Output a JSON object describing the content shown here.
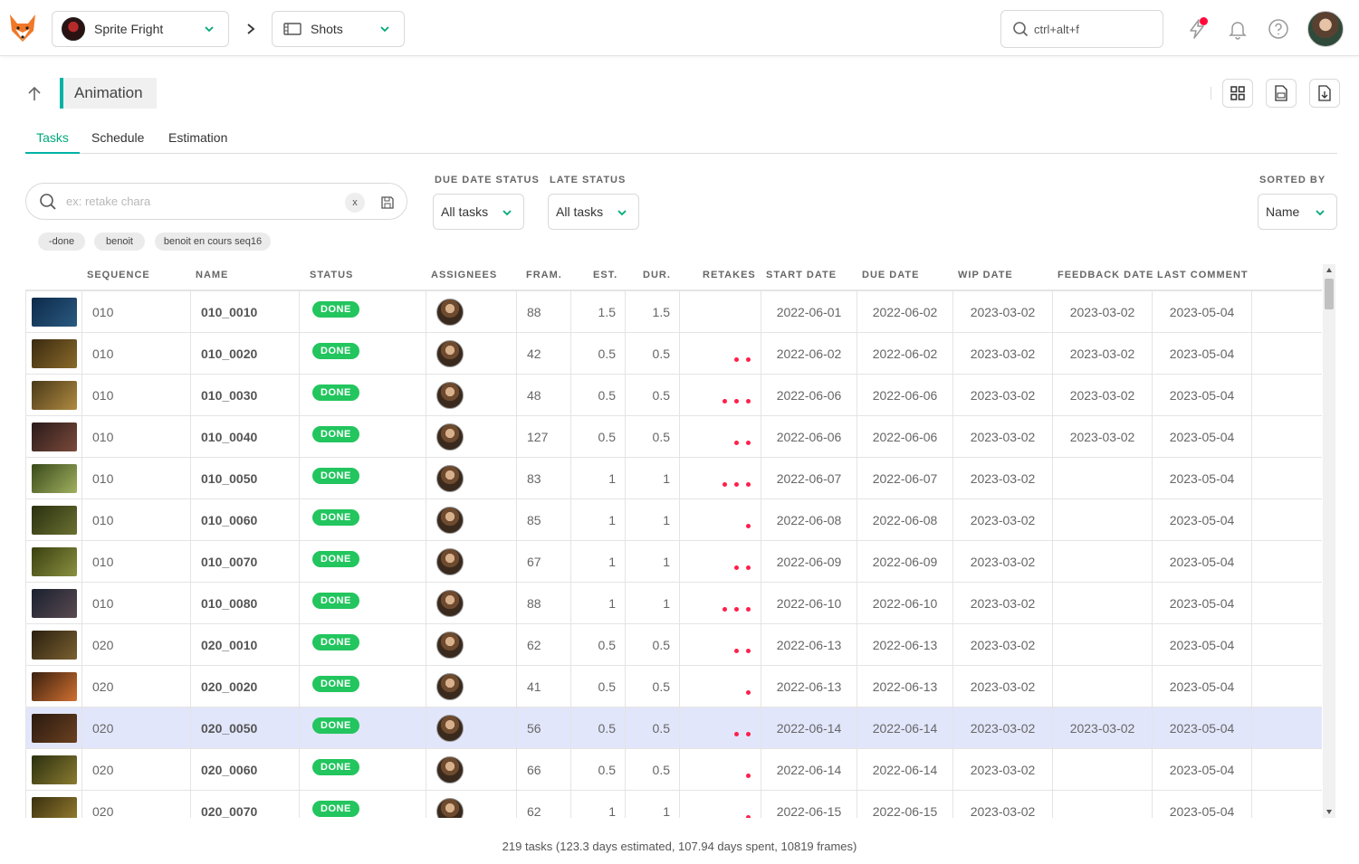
{
  "topbar": {
    "production": "Sprite Fright",
    "section": "Shots",
    "search_placeholder": "ctrl+alt+f"
  },
  "header": {
    "title": "Animation"
  },
  "tabs": [
    {
      "label": "Tasks",
      "active": true
    },
    {
      "label": "Schedule",
      "active": false
    },
    {
      "label": "Estimation",
      "active": false
    }
  ],
  "filters": {
    "search_placeholder": "ex: retake chara",
    "clear_label": "x",
    "chips": [
      "-done",
      "benoit",
      "benoit en cours seq16"
    ],
    "due_date_status_label": "DUE DATE STATUS",
    "due_date_status_value": "All tasks",
    "late_status_label": "LATE STATUS",
    "late_status_value": "All tasks",
    "sorted_by_label": "SORTED BY",
    "sorted_by_value": "Name"
  },
  "table": {
    "columns": [
      "SEQUENCE",
      "NAME",
      "STATUS",
      "ASSIGNEES",
      "FRAM.",
      "EST.",
      "DUR.",
      "RETAKES",
      "START DATE",
      "DUE DATE",
      "WIP DATE",
      "FEEDBACK DATE",
      "LAST COMMENT"
    ],
    "rows": [
      {
        "seq": "010",
        "name": "010_0010",
        "status": "DONE",
        "frames": "88",
        "est": "1.5",
        "dur": "1.5",
        "retakes": 0,
        "start": "2022-06-01",
        "due": "2022-06-02",
        "wip": "2023-03-02",
        "feedback": "2023-03-02",
        "last_comment": "2023-05-04",
        "selected": false
      },
      {
        "seq": "010",
        "name": "010_0020",
        "status": "DONE",
        "frames": "42",
        "est": "0.5",
        "dur": "0.5",
        "retakes": 2,
        "start": "2022-06-02",
        "due": "2022-06-02",
        "wip": "2023-03-02",
        "feedback": "2023-03-02",
        "last_comment": "2023-05-04",
        "selected": false
      },
      {
        "seq": "010",
        "name": "010_0030",
        "status": "DONE",
        "frames": "48",
        "est": "0.5",
        "dur": "0.5",
        "retakes": 3,
        "start": "2022-06-06",
        "due": "2022-06-06",
        "wip": "2023-03-02",
        "feedback": "2023-03-02",
        "last_comment": "2023-05-04",
        "selected": false
      },
      {
        "seq": "010",
        "name": "010_0040",
        "status": "DONE",
        "frames": "127",
        "est": "0.5",
        "dur": "0.5",
        "retakes": 2,
        "start": "2022-06-06",
        "due": "2022-06-06",
        "wip": "2023-03-02",
        "feedback": "2023-03-02",
        "last_comment": "2023-05-04",
        "selected": false
      },
      {
        "seq": "010",
        "name": "010_0050",
        "status": "DONE",
        "frames": "83",
        "est": "1",
        "dur": "1",
        "retakes": 3,
        "start": "2022-06-07",
        "due": "2022-06-07",
        "wip": "2023-03-02",
        "feedback": "",
        "last_comment": "2023-05-04",
        "selected": false
      },
      {
        "seq": "010",
        "name": "010_0060",
        "status": "DONE",
        "frames": "85",
        "est": "1",
        "dur": "1",
        "retakes": 1,
        "start": "2022-06-08",
        "due": "2022-06-08",
        "wip": "2023-03-02",
        "feedback": "",
        "last_comment": "2023-05-04",
        "selected": false
      },
      {
        "seq": "010",
        "name": "010_0070",
        "status": "DONE",
        "frames": "67",
        "est": "1",
        "dur": "1",
        "retakes": 2,
        "start": "2022-06-09",
        "due": "2022-06-09",
        "wip": "2023-03-02",
        "feedback": "",
        "last_comment": "2023-05-04",
        "selected": false
      },
      {
        "seq": "010",
        "name": "010_0080",
        "status": "DONE",
        "frames": "88",
        "est": "1",
        "dur": "1",
        "retakes": 3,
        "start": "2022-06-10",
        "due": "2022-06-10",
        "wip": "2023-03-02",
        "feedback": "",
        "last_comment": "2023-05-04",
        "selected": false
      },
      {
        "seq": "020",
        "name": "020_0010",
        "status": "DONE",
        "frames": "62",
        "est": "0.5",
        "dur": "0.5",
        "retakes": 2,
        "start": "2022-06-13",
        "due": "2022-06-13",
        "wip": "2023-03-02",
        "feedback": "",
        "last_comment": "2023-05-04",
        "selected": false
      },
      {
        "seq": "020",
        "name": "020_0020",
        "status": "DONE",
        "frames": "41",
        "est": "0.5",
        "dur": "0.5",
        "retakes": 1,
        "start": "2022-06-13",
        "due": "2022-06-13",
        "wip": "2023-03-02",
        "feedback": "",
        "last_comment": "2023-05-04",
        "selected": false
      },
      {
        "seq": "020",
        "name": "020_0050",
        "status": "DONE",
        "frames": "56",
        "est": "0.5",
        "dur": "0.5",
        "retakes": 2,
        "start": "2022-06-14",
        "due": "2022-06-14",
        "wip": "2023-03-02",
        "feedback": "2023-03-02",
        "last_comment": "2023-05-04",
        "selected": true
      },
      {
        "seq": "020",
        "name": "020_0060",
        "status": "DONE",
        "frames": "66",
        "est": "0.5",
        "dur": "0.5",
        "retakes": 1,
        "start": "2022-06-14",
        "due": "2022-06-14",
        "wip": "2023-03-02",
        "feedback": "",
        "last_comment": "2023-05-04",
        "selected": false
      },
      {
        "seq": "020",
        "name": "020_0070",
        "status": "DONE",
        "frames": "62",
        "est": "1",
        "dur": "1",
        "retakes": 1,
        "start": "2022-06-15",
        "due": "2022-06-15",
        "wip": "2023-03-02",
        "feedback": "",
        "last_comment": "2023-05-04",
        "selected": false
      }
    ]
  },
  "footer": {
    "summary": "219 tasks (123.3 days estimated, 107.94 days spent, 10819 frames)"
  },
  "colors": {
    "accent": "#00b3a4",
    "status_done": "#22c55e",
    "retake_dot": "#ff1f4b",
    "selected_row": "#e2e6fb",
    "notification": "#ff0a3a"
  }
}
